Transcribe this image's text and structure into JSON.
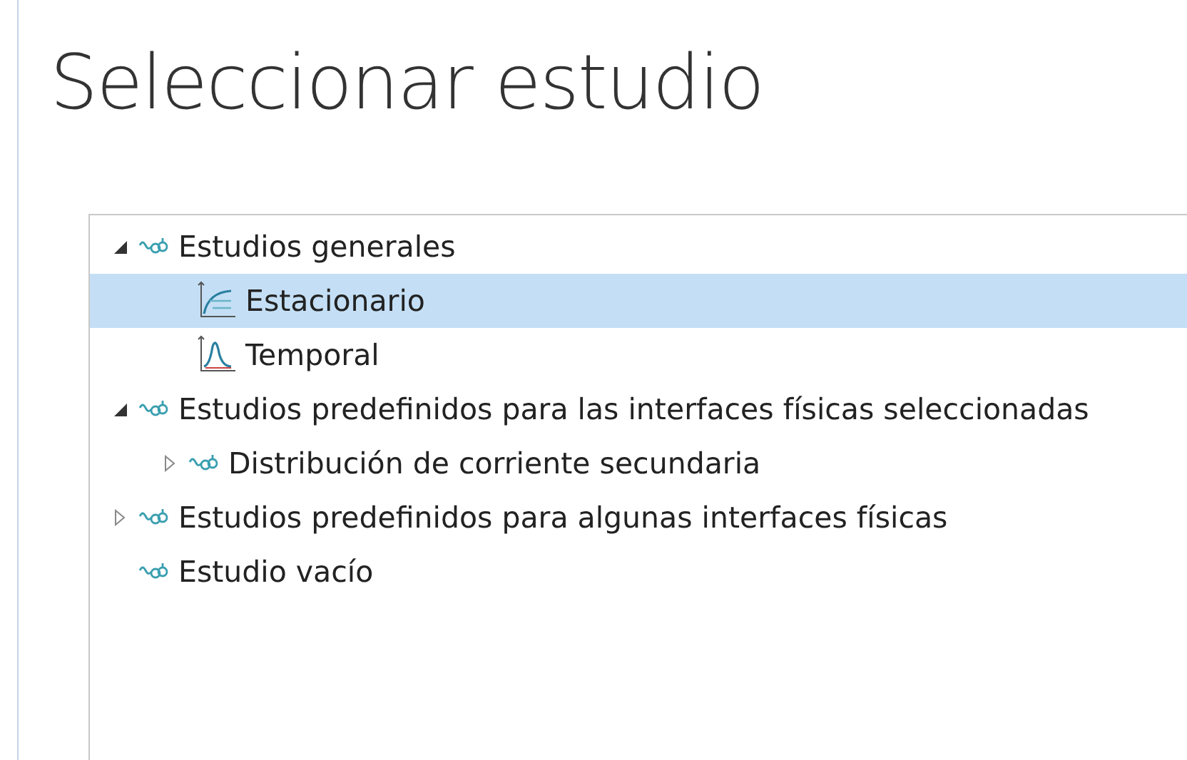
{
  "title": "Seleccionar estudio",
  "tree": [
    {
      "label": "Estudios generales",
      "kind": "study",
      "expanded": true,
      "selected": false,
      "children": [
        {
          "label": "Estacionario",
          "kind": "stationary",
          "selected": true
        },
        {
          "label": "Temporal",
          "kind": "time",
          "selected": false
        }
      ]
    },
    {
      "label": "Estudios predefinidos para las interfaces físicas seleccionadas",
      "kind": "study",
      "expanded": true,
      "selected": false,
      "children": [
        {
          "label": "Distribución de corriente secundaria",
          "kind": "study",
          "expanded": false,
          "selected": false
        }
      ]
    },
    {
      "label": "Estudios predefinidos para algunas interfaces físicas",
      "kind": "study",
      "expanded": false,
      "selected": false
    },
    {
      "label": "Estudio vacío",
      "kind": "study",
      "selected": false
    }
  ]
}
